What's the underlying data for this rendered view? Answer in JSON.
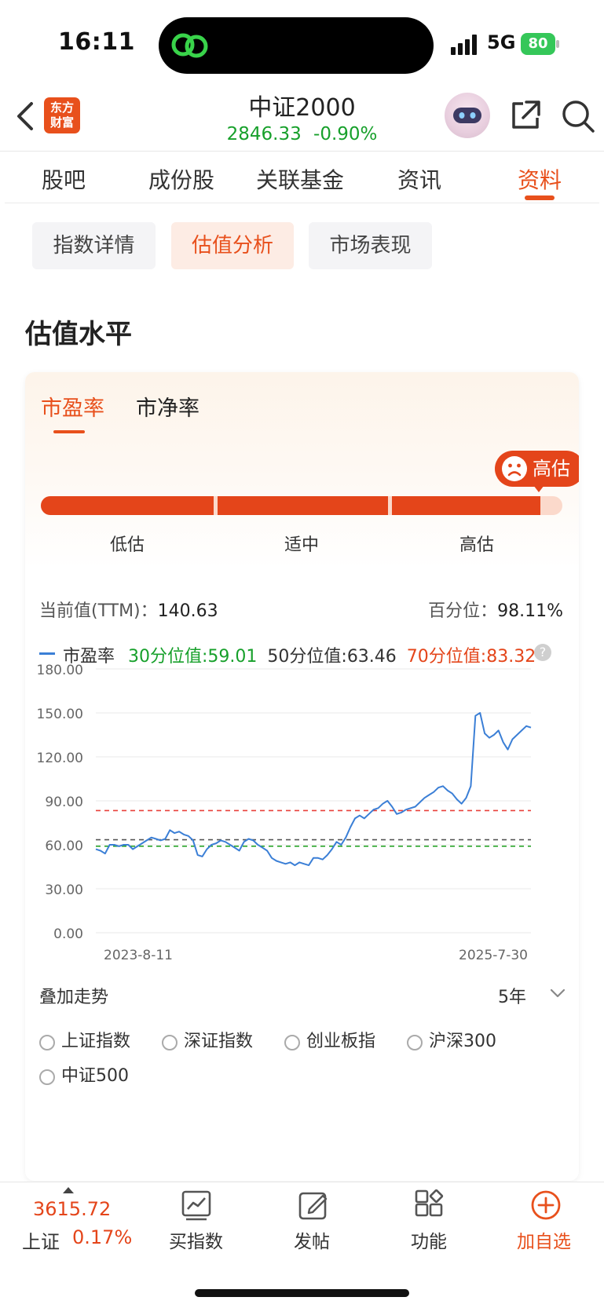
{
  "status_bar": {
    "time": "16:11",
    "network": "5G",
    "battery": "80"
  },
  "header": {
    "logo_line1": "东方",
    "logo_line2": "财富",
    "title": "中证2000",
    "price": "2846.33",
    "change": "-0.90%"
  },
  "tabs": [
    {
      "label": "股吧"
    },
    {
      "label": "成份股"
    },
    {
      "label": "关联基金"
    },
    {
      "label": "资讯"
    },
    {
      "label": "资料"
    }
  ],
  "subtabs": [
    {
      "label": "指数详情"
    },
    {
      "label": "估值分析"
    },
    {
      "label": "市场表现"
    }
  ],
  "section_title": "估值水平",
  "card": {
    "tabs": [
      {
        "label": "市盈率"
      },
      {
        "label": "市净率"
      }
    ],
    "badge": "高估",
    "level_fill": 0.958,
    "levels": [
      "低估",
      "适中",
      "高估"
    ],
    "current_label": "当前值(TTM)：",
    "current_value": "140.63",
    "percentile_label": "百分位：",
    "percentile_value": "98.11%",
    "legend_series": "市盈率",
    "q30": "30分位值:59.01",
    "q50": "50分位值:63.46",
    "q70": "70分位值:83.32",
    "help": "?"
  },
  "chart_data": {
    "type": "line",
    "ylim": [
      0,
      180
    ],
    "yticks": [
      "180.00",
      "150.00",
      "120.00",
      "90.00",
      "60.00",
      "30.00",
      "0.00"
    ],
    "x_start_label": "2023-8-11",
    "x_end_label": "2025-7-30",
    "grid": true,
    "series": [
      {
        "values": [
          57,
          56,
          54,
          60,
          60,
          59,
          60,
          60,
          57,
          59,
          61,
          63,
          65,
          64,
          63,
          64,
          70,
          68,
          69,
          67,
          66,
          63,
          53,
          52,
          57,
          60,
          61,
          63,
          62,
          60,
          58,
          56,
          62,
          64,
          63,
          60,
          58,
          56,
          51,
          49,
          48,
          47,
          48,
          46,
          48,
          47,
          46,
          51,
          51,
          50,
          53,
          57,
          62,
          60,
          65,
          72,
          78,
          80,
          78,
          81,
          84,
          85,
          88,
          90,
          86,
          81,
          82,
          84,
          85,
          86,
          89,
          92,
          94,
          96,
          99,
          100,
          97,
          95,
          91,
          88,
          92,
          100,
          148,
          150,
          136,
          133,
          135,
          138,
          130,
          125,
          132,
          135,
          138,
          141,
          140
        ]
      }
    ],
    "reference_lines": [
      {
        "value": 59.01,
        "color": "#2aa52a"
      },
      {
        "value": 63.46,
        "color": "#555555"
      },
      {
        "value": 83.32,
        "color": "#e8403a"
      }
    ]
  },
  "overlay": {
    "label": "叠加走势",
    "period": "5年",
    "options": [
      "上证指数",
      "深证指数",
      "创业板指",
      "沪深300",
      "中证500"
    ]
  },
  "bottom_bar": {
    "index_value": "3615.72",
    "index_name": "上证",
    "index_change": "0.17%",
    "items": [
      "买指数",
      "发帖",
      "功能",
      "加自选"
    ]
  },
  "colors": {
    "accent": "#e8501c",
    "down": "#17a02b",
    "line": "#3b7fd6"
  }
}
